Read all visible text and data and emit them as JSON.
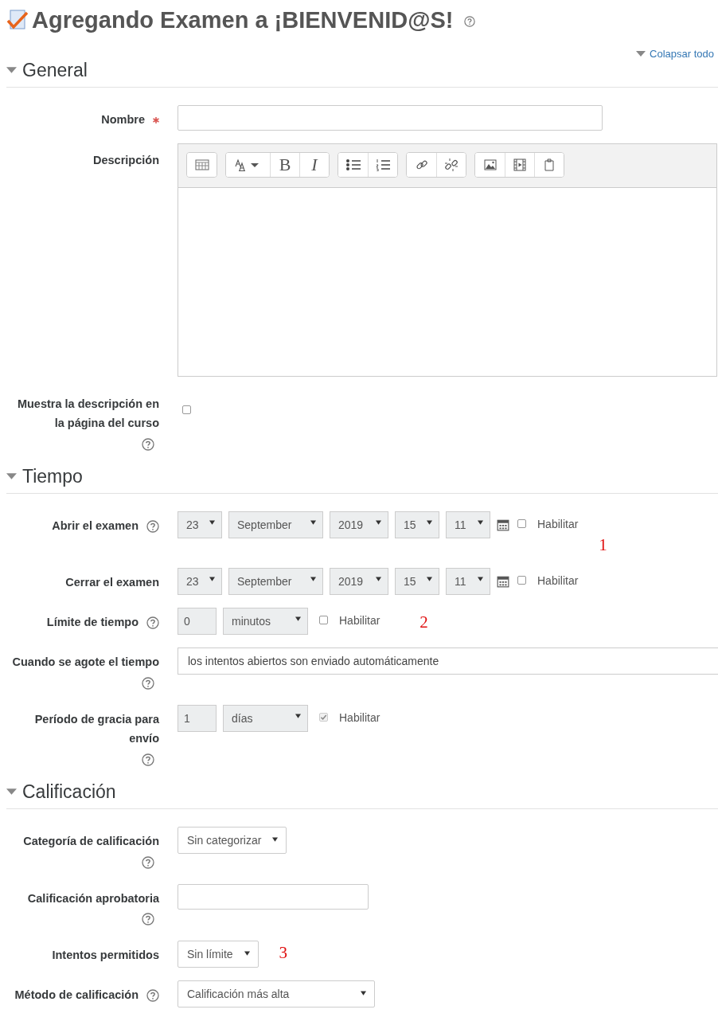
{
  "title": "Agregando Examen a ¡BIENVENID@S!",
  "collapse_all": "Colapsar todo",
  "sections": [
    {
      "title": "General",
      "expanded": true,
      "fields": [
        {
          "kind": "text",
          "label": "Nombre",
          "required": true
        },
        {
          "kind": "editor",
          "label": "Descripción",
          "toolbar": [
            [
              {
                "kind": "table"
              }
            ],
            [
              {
                "kind": "fontsize"
              },
              {
                "kind": "bold",
                "text": "B"
              },
              {
                "kind": "italic",
                "text": "I"
              }
            ],
            [
              {
                "kind": "bullets"
              },
              {
                "kind": "numbers"
              }
            ],
            [
              {
                "kind": "link"
              },
              {
                "kind": "unlink"
              }
            ],
            [
              {
                "kind": "image"
              },
              {
                "kind": "video"
              },
              {
                "kind": "paste"
              }
            ]
          ]
        },
        {
          "kind": "checkbox",
          "label": "Muestra la descripción en la página del curso",
          "help": true,
          "checked": false
        }
      ]
    },
    {
      "title": "Tiempo",
      "expanded": true,
      "fields": [
        {
          "kind": "datetime",
          "label": "Abrir el examen",
          "help": true,
          "help_below": false,
          "parts": [
            "23",
            "September",
            "2019",
            "15",
            "11"
          ],
          "enable": {
            "label": "Habilitar",
            "checked": false
          },
          "annotation": "1"
        },
        {
          "kind": "datetime",
          "label": "Cerrar el examen",
          "parts": [
            "23",
            "September",
            "2019",
            "15",
            "11"
          ],
          "enable": {
            "label": "Habilitar",
            "checked": false
          }
        },
        {
          "kind": "duration",
          "label": "Límite de tiempo",
          "help": true,
          "help_below": false,
          "value": "0",
          "unit": "minutos",
          "enable": {
            "label": "Habilitar",
            "checked": false
          },
          "annotation": "2"
        },
        {
          "kind": "wide-select",
          "label": "Cuando se agote el tiempo",
          "help": true,
          "help_below": true,
          "value": "los intentos abiertos son enviado automáticamente"
        },
        {
          "kind": "duration",
          "label": "Período de gracia para envío",
          "help": true,
          "help_below": true,
          "value": "1",
          "unit": "días",
          "enable": {
            "label": "Habilitar",
            "checked": true
          }
        }
      ]
    },
    {
      "title": "Calificación",
      "expanded": true,
      "fields": [
        {
          "kind": "select",
          "label": "Categoría de calificación",
          "help": true,
          "help_below": true,
          "value": "Sin categorizar"
        },
        {
          "kind": "text",
          "label": "Calificación aprobatoria",
          "help": true,
          "help_below": true,
          "required": false
        },
        {
          "kind": "select",
          "label": "Intentos permitidos",
          "value": "Sin límite",
          "annotation": "3"
        },
        {
          "kind": "select",
          "label": "Método de calificación",
          "help": true,
          "help_below": false,
          "value": "Calificación más alta"
        }
      ]
    }
  ]
}
